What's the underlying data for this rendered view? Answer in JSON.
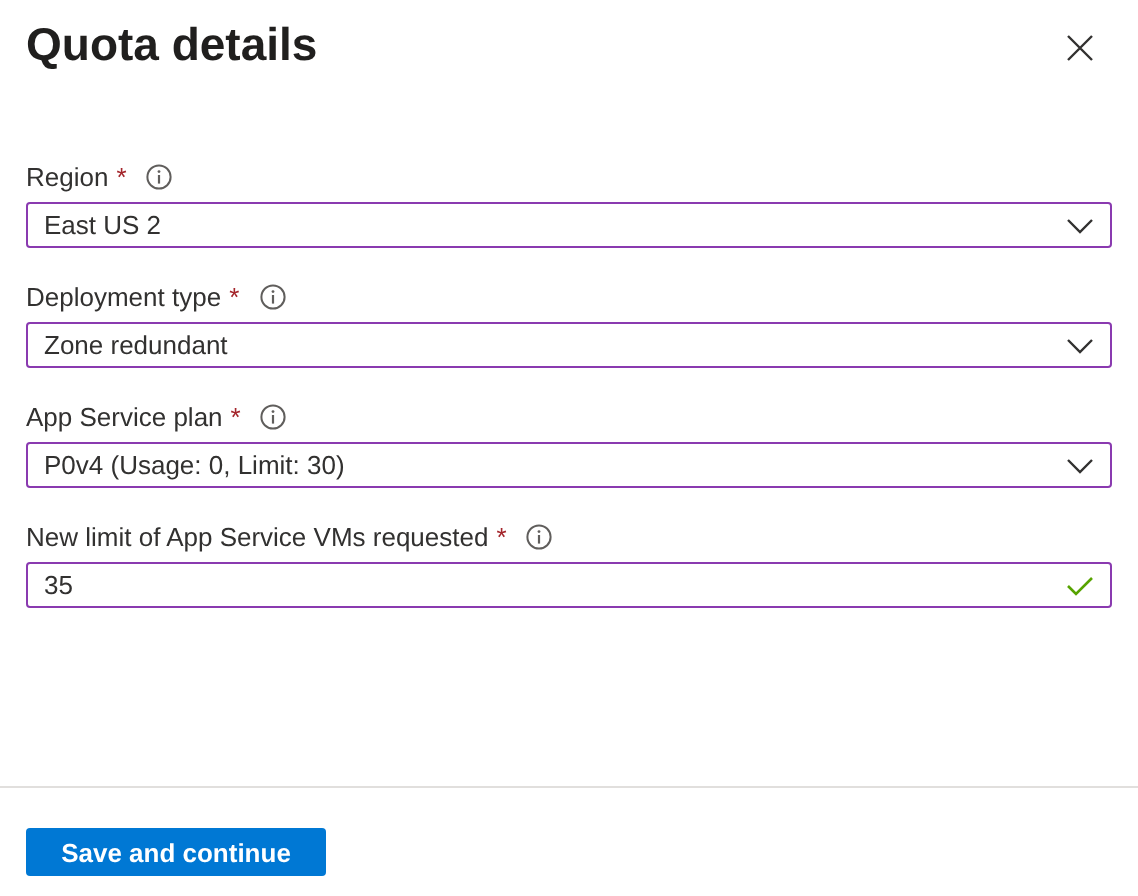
{
  "panel": {
    "title": "Quota details"
  },
  "fields": [
    {
      "label": "Region",
      "required_mark": "*",
      "kind": "dropdown",
      "value": "East US 2"
    },
    {
      "label": "Deployment type",
      "required_mark": "*",
      "kind": "dropdown",
      "value": "Zone redundant"
    },
    {
      "label": "App Service plan",
      "required_mark": "*",
      "kind": "dropdown",
      "value": "P0v4 (Usage: 0, Limit: 30)"
    },
    {
      "label": "New limit of App Service VMs requested",
      "required_mark": "*",
      "kind": "text",
      "value": "35",
      "valid": true
    }
  ],
  "footer": {
    "button": "Save and continue"
  }
}
